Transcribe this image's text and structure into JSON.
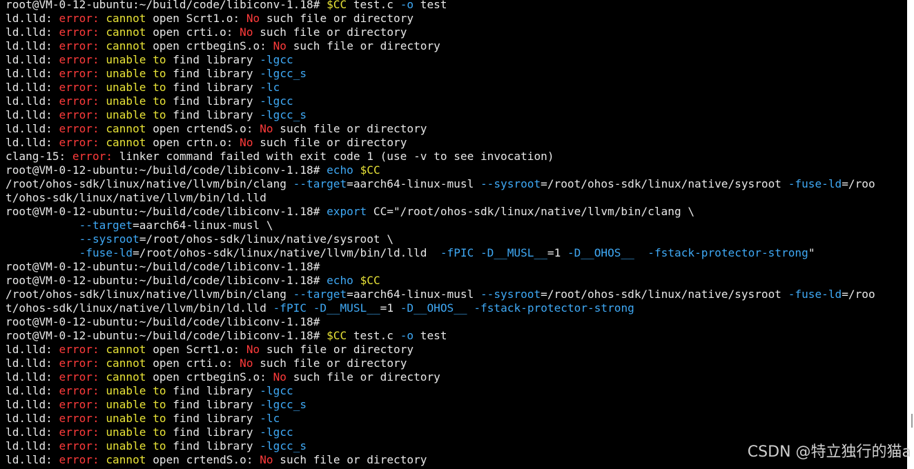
{
  "colors": {
    "background": "#000000",
    "plain": "#e8e8e8",
    "red": "#ff3b3b",
    "yellow": "#e8e337",
    "cyan": "#3fa9f5"
  },
  "watermark": "CSDN @特立独行的猫a",
  "lines": [
    [
      [
        "p",
        "root@VM-0-12-ubuntu:~/build/code/libiconv-1.18# "
      ],
      [
        "y",
        "$CC"
      ],
      [
        "p",
        " test.c "
      ],
      [
        "c",
        "-o"
      ],
      [
        "p",
        " test"
      ]
    ],
    [
      [
        "p",
        "ld.lld: "
      ],
      [
        "r",
        "error:"
      ],
      [
        "p",
        " "
      ],
      [
        "y",
        "cannot"
      ],
      [
        "p",
        " open Scrt1.o: "
      ],
      [
        "r",
        "No"
      ],
      [
        "p",
        " such file or directory"
      ]
    ],
    [
      [
        "p",
        "ld.lld: "
      ],
      [
        "r",
        "error:"
      ],
      [
        "p",
        " "
      ],
      [
        "y",
        "cannot"
      ],
      [
        "p",
        " open crti.o: "
      ],
      [
        "r",
        "No"
      ],
      [
        "p",
        " such file or directory"
      ]
    ],
    [
      [
        "p",
        "ld.lld: "
      ],
      [
        "r",
        "error:"
      ],
      [
        "p",
        " "
      ],
      [
        "y",
        "cannot"
      ],
      [
        "p",
        " open crtbeginS.o: "
      ],
      [
        "r",
        "No"
      ],
      [
        "p",
        " such file or directory"
      ]
    ],
    [
      [
        "p",
        "ld.lld: "
      ],
      [
        "r",
        "error:"
      ],
      [
        "p",
        " "
      ],
      [
        "y",
        "unable"
      ],
      [
        "p",
        " "
      ],
      [
        "y",
        "to"
      ],
      [
        "p",
        " find library "
      ],
      [
        "c",
        "-lgcc"
      ]
    ],
    [
      [
        "p",
        "ld.lld: "
      ],
      [
        "r",
        "error:"
      ],
      [
        "p",
        " "
      ],
      [
        "y",
        "unable"
      ],
      [
        "p",
        " "
      ],
      [
        "y",
        "to"
      ],
      [
        "p",
        " find library "
      ],
      [
        "c",
        "-lgcc_s"
      ]
    ],
    [
      [
        "p",
        "ld.lld: "
      ],
      [
        "r",
        "error:"
      ],
      [
        "p",
        " "
      ],
      [
        "y",
        "unable"
      ],
      [
        "p",
        " "
      ],
      [
        "y",
        "to"
      ],
      [
        "p",
        " find library "
      ],
      [
        "c",
        "-lc"
      ]
    ],
    [
      [
        "p",
        "ld.lld: "
      ],
      [
        "r",
        "error:"
      ],
      [
        "p",
        " "
      ],
      [
        "y",
        "unable"
      ],
      [
        "p",
        " "
      ],
      [
        "y",
        "to"
      ],
      [
        "p",
        " find library "
      ],
      [
        "c",
        "-lgcc"
      ]
    ],
    [
      [
        "p",
        "ld.lld: "
      ],
      [
        "r",
        "error:"
      ],
      [
        "p",
        " "
      ],
      [
        "y",
        "unable"
      ],
      [
        "p",
        " "
      ],
      [
        "y",
        "to"
      ],
      [
        "p",
        " find library "
      ],
      [
        "c",
        "-lgcc_s"
      ]
    ],
    [
      [
        "p",
        "ld.lld: "
      ],
      [
        "r",
        "error:"
      ],
      [
        "p",
        " "
      ],
      [
        "y",
        "cannot"
      ],
      [
        "p",
        " open crtendS.o: "
      ],
      [
        "r",
        "No"
      ],
      [
        "p",
        " such file or directory"
      ]
    ],
    [
      [
        "p",
        "ld.lld: "
      ],
      [
        "r",
        "error:"
      ],
      [
        "p",
        " "
      ],
      [
        "y",
        "cannot"
      ],
      [
        "p",
        " open crtn.o: "
      ],
      [
        "r",
        "No"
      ],
      [
        "p",
        " such file or directory"
      ]
    ],
    [
      [
        "p",
        "clang-15: "
      ],
      [
        "r",
        "error:"
      ],
      [
        "p",
        " linker command failed with exit code 1 (use -v to see invocation)"
      ]
    ],
    [
      [
        "p",
        "root@VM-0-12-ubuntu:~/build/code/libiconv-1.18# "
      ],
      [
        "c",
        "echo"
      ],
      [
        "p",
        " "
      ],
      [
        "y",
        "$CC"
      ]
    ],
    [
      [
        "p",
        "/root/ohos-sdk/linux/native/llvm/bin/clang "
      ],
      [
        "c",
        "--target"
      ],
      [
        "p",
        "=aarch64-linux-musl "
      ],
      [
        "c",
        "--sysroot"
      ],
      [
        "p",
        "=/root/ohos-sdk/linux/native/sysroot "
      ],
      [
        "c",
        "-fuse-ld"
      ],
      [
        "p",
        "=/roo"
      ]
    ],
    [
      [
        "p",
        "t/ohos-sdk/linux/native/llvm/bin/ld.lld"
      ]
    ],
    [
      [
        "p",
        "root@VM-0-12-ubuntu:~/build/code/libiconv-1.18# "
      ],
      [
        "c",
        "export"
      ],
      [
        "p",
        " CC=\"/root/ohos-sdk/linux/native/llvm/bin/clang \\"
      ]
    ],
    [
      [
        "p",
        "           "
      ],
      [
        "c",
        "--target"
      ],
      [
        "p",
        "=aarch64-linux-musl \\"
      ]
    ],
    [
      [
        "p",
        "           "
      ],
      [
        "c",
        "--sysroot"
      ],
      [
        "p",
        "=/root/ohos-sdk/linux/native/sysroot \\"
      ]
    ],
    [
      [
        "p",
        "           "
      ],
      [
        "c",
        "-fuse-ld"
      ],
      [
        "p",
        "=/root/ohos-sdk/linux/native/llvm/bin/ld.lld  "
      ],
      [
        "c",
        "-fPIC"
      ],
      [
        "p",
        " "
      ],
      [
        "c",
        "-D__MUSL__"
      ],
      [
        "p",
        "=1 "
      ],
      [
        "c",
        "-D__OHOS__"
      ],
      [
        "p",
        "  "
      ],
      [
        "c",
        "-fstack-protector-strong"
      ],
      [
        "p",
        "\""
      ]
    ],
    [
      [
        "p",
        "root@VM-0-12-ubuntu:~/build/code/libiconv-1.18#"
      ]
    ],
    [
      [
        "p",
        "root@VM-0-12-ubuntu:~/build/code/libiconv-1.18# "
      ],
      [
        "c",
        "echo"
      ],
      [
        "p",
        " "
      ],
      [
        "y",
        "$CC"
      ]
    ],
    [
      [
        "p",
        "/root/ohos-sdk/linux/native/llvm/bin/clang "
      ],
      [
        "c",
        "--target"
      ],
      [
        "p",
        "=aarch64-linux-musl "
      ],
      [
        "c",
        "--sysroot"
      ],
      [
        "p",
        "=/root/ohos-sdk/linux/native/sysroot "
      ],
      [
        "c",
        "-fuse-ld"
      ],
      [
        "p",
        "=/roo"
      ]
    ],
    [
      [
        "p",
        "t/ohos-sdk/linux/native/llvm/bin/ld.lld "
      ],
      [
        "c",
        "-fPIC"
      ],
      [
        "p",
        " "
      ],
      [
        "c",
        "-D__MUSL__"
      ],
      [
        "p",
        "=1 "
      ],
      [
        "c",
        "-D__OHOS__"
      ],
      [
        "p",
        " "
      ],
      [
        "c",
        "-fstack-protector-strong"
      ]
    ],
    [
      [
        "p",
        "root@VM-0-12-ubuntu:~/build/code/libiconv-1.18#"
      ]
    ],
    [
      [
        "p",
        "root@VM-0-12-ubuntu:~/build/code/libiconv-1.18# "
      ],
      [
        "y",
        "$CC"
      ],
      [
        "p",
        " test.c "
      ],
      [
        "c",
        "-o"
      ],
      [
        "p",
        " test"
      ]
    ],
    [
      [
        "p",
        "ld.lld: "
      ],
      [
        "r",
        "error:"
      ],
      [
        "p",
        " "
      ],
      [
        "y",
        "cannot"
      ],
      [
        "p",
        " open Scrt1.o: "
      ],
      [
        "r",
        "No"
      ],
      [
        "p",
        " such file or directory"
      ]
    ],
    [
      [
        "p",
        "ld.lld: "
      ],
      [
        "r",
        "error:"
      ],
      [
        "p",
        " "
      ],
      [
        "y",
        "cannot"
      ],
      [
        "p",
        " open crti.o: "
      ],
      [
        "r",
        "No"
      ],
      [
        "p",
        " such file or directory"
      ]
    ],
    [
      [
        "p",
        "ld.lld: "
      ],
      [
        "r",
        "error:"
      ],
      [
        "p",
        " "
      ],
      [
        "y",
        "cannot"
      ],
      [
        "p",
        " open crtbeginS.o: "
      ],
      [
        "r",
        "No"
      ],
      [
        "p",
        " such file or directory"
      ]
    ],
    [
      [
        "p",
        "ld.lld: "
      ],
      [
        "r",
        "error:"
      ],
      [
        "p",
        " "
      ],
      [
        "y",
        "unable"
      ],
      [
        "p",
        " "
      ],
      [
        "y",
        "to"
      ],
      [
        "p",
        " find library "
      ],
      [
        "c",
        "-lgcc"
      ]
    ],
    [
      [
        "p",
        "ld.lld: "
      ],
      [
        "r",
        "error:"
      ],
      [
        "p",
        " "
      ],
      [
        "y",
        "unable"
      ],
      [
        "p",
        " "
      ],
      [
        "y",
        "to"
      ],
      [
        "p",
        " find library "
      ],
      [
        "c",
        "-lgcc_s"
      ]
    ],
    [
      [
        "p",
        "ld.lld: "
      ],
      [
        "r",
        "error:"
      ],
      [
        "p",
        " "
      ],
      [
        "y",
        "unable"
      ],
      [
        "p",
        " "
      ],
      [
        "y",
        "to"
      ],
      [
        "p",
        " find library "
      ],
      [
        "c",
        "-lc"
      ]
    ],
    [
      [
        "p",
        "ld.lld: "
      ],
      [
        "r",
        "error:"
      ],
      [
        "p",
        " "
      ],
      [
        "y",
        "unable"
      ],
      [
        "p",
        " "
      ],
      [
        "y",
        "to"
      ],
      [
        "p",
        " find library "
      ],
      [
        "c",
        "-lgcc"
      ]
    ],
    [
      [
        "p",
        "ld.lld: "
      ],
      [
        "r",
        "error:"
      ],
      [
        "p",
        " "
      ],
      [
        "y",
        "unable"
      ],
      [
        "p",
        " "
      ],
      [
        "y",
        "to"
      ],
      [
        "p",
        " find library "
      ],
      [
        "c",
        "-lgcc_s"
      ]
    ],
    [
      [
        "p",
        "ld.lld: "
      ],
      [
        "r",
        "error:"
      ],
      [
        "p",
        " "
      ],
      [
        "y",
        "cannot"
      ],
      [
        "p",
        " open crtendS.o: "
      ],
      [
        "r",
        "No"
      ],
      [
        "p",
        " such file or directory"
      ]
    ]
  ]
}
